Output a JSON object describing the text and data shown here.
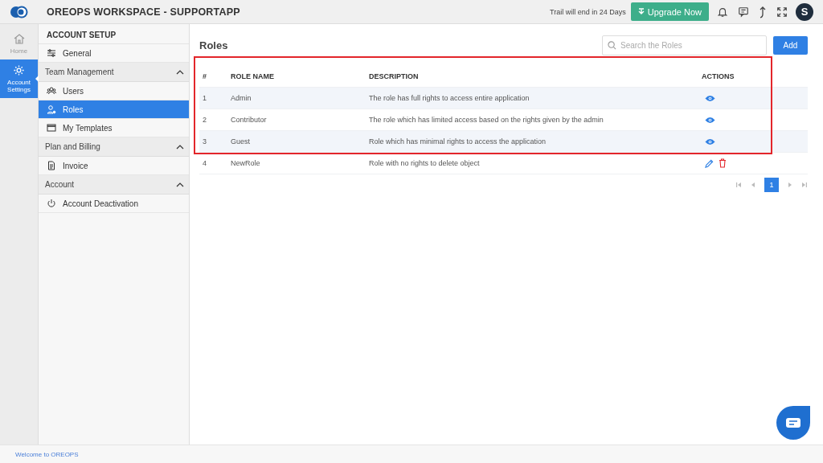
{
  "app": {
    "title": "OREOPS WORKSPACE - SUPPORTAPP",
    "trial_notice": "Trail will end in 24 Days",
    "upgrade_button": "Upgrade Now",
    "avatar_initial": "S"
  },
  "rail": [
    {
      "label": "Home",
      "selected": false
    },
    {
      "label": "Account Settings",
      "selected": true
    }
  ],
  "sidebar": {
    "title": "ACCOUNT SETUP",
    "items": [
      {
        "kind": "item",
        "label": "General",
        "selected": false
      },
      {
        "kind": "section",
        "label": "Team Management",
        "expanded": true
      },
      {
        "kind": "item",
        "label": "Users",
        "selected": false
      },
      {
        "kind": "item",
        "label": "Roles",
        "selected": true
      },
      {
        "kind": "item",
        "label": "My Templates",
        "selected": false
      },
      {
        "kind": "section",
        "label": "Plan and Billing",
        "expanded": true
      },
      {
        "kind": "item",
        "label": "Invoice",
        "selected": false
      },
      {
        "kind": "section",
        "label": "Account",
        "expanded": true
      },
      {
        "kind": "item",
        "label": "Account Deactivation",
        "selected": false
      }
    ]
  },
  "page": {
    "title": "Roles",
    "search": {
      "placeholder": "Search the Roles"
    },
    "add_button": "Add"
  },
  "table": {
    "columns": [
      "#",
      "ROLE NAME",
      "DESCRIPTION",
      "ACTIONS"
    ],
    "rows": [
      {
        "number": "1",
        "name": "Admin",
        "description": "The role has full rights to access entire application",
        "editable": false,
        "highlighted": true
      },
      {
        "number": "2",
        "name": "Contributor",
        "description": "The role which has limited access based on the rights given by the admin",
        "editable": false,
        "highlighted": true
      },
      {
        "number": "3",
        "name": "Guest",
        "description": "Role which has minimal rights to access the application",
        "editable": false,
        "highlighted": true
      },
      {
        "number": "4",
        "name": "NewRole",
        "description": "Role with no rights to delete object",
        "editable": true,
        "highlighted": false
      }
    ]
  },
  "pagination": {
    "pages": [
      {
        "label": "1",
        "selected": true
      }
    ]
  },
  "status_bar": {
    "text": "Welcome to OREOPS"
  }
}
